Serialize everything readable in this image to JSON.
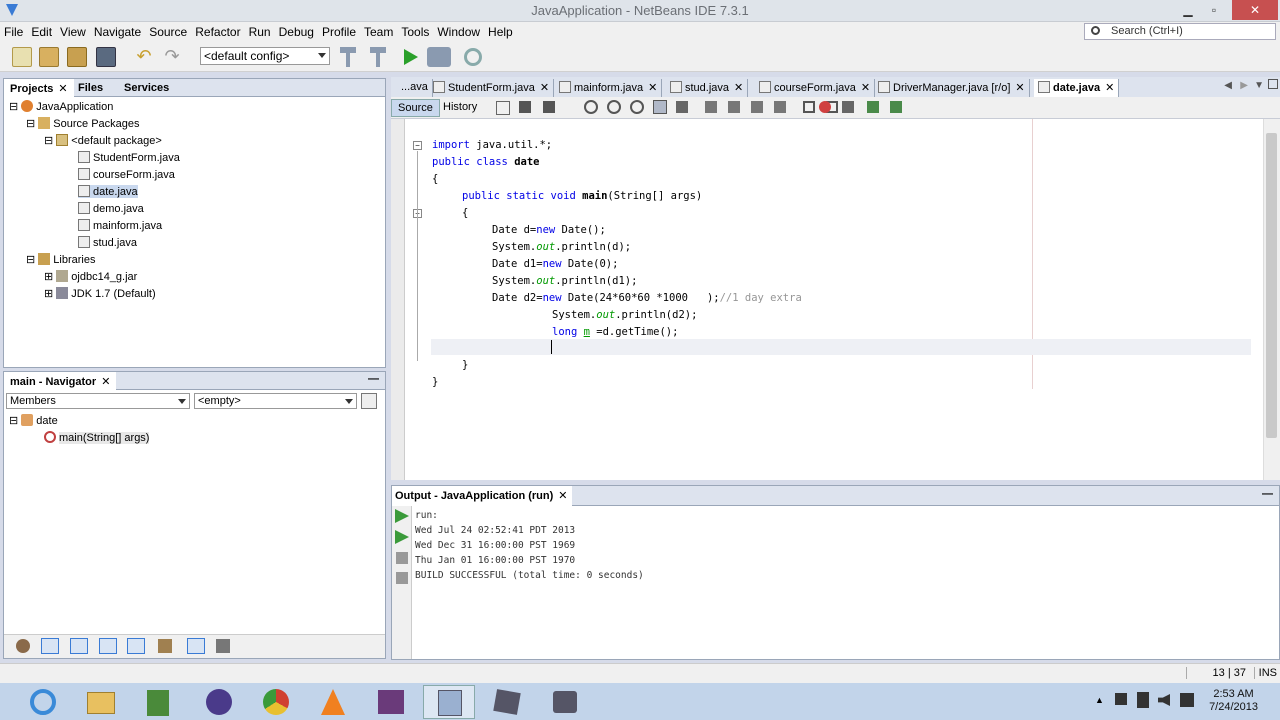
{
  "window": {
    "title": "JavaApplication - NetBeans IDE 7.3.1"
  },
  "menu": [
    "File",
    "Edit",
    "View",
    "Navigate",
    "Source",
    "Refactor",
    "Run",
    "Debug",
    "Profile",
    "Team",
    "Tools",
    "Window",
    "Help"
  ],
  "search": {
    "placeholder": "Search (Ctrl+I)"
  },
  "toolbar": {
    "config": "<default config>"
  },
  "projects": {
    "tabs": [
      "Projects",
      "Files",
      "Services"
    ],
    "tree": [
      "JavaApplication",
      "Source Packages",
      "<default package>",
      "StudentForm.java",
      "courseForm.java",
      "date.java",
      "demo.java",
      "mainform.java",
      "stud.java",
      "Libraries",
      "ojdbc14_g.jar",
      "JDK 1.7 (Default)"
    ]
  },
  "navigator": {
    "title": "main - Navigator",
    "members_label": "Members",
    "filter": "<empty>",
    "class_name": "date",
    "method": "main(String[] args)"
  },
  "editor": {
    "tabs": [
      "...ava",
      "StudentForm.java",
      "mainform.java",
      "stud.java",
      "courseForm.java",
      "DriverManager.java [r/o]",
      "date.java"
    ],
    "source_label": "Source",
    "history_label": "History"
  },
  "output": {
    "title": "Output - JavaApplication (run)",
    "lines": [
      "run:",
      "Wed Jul 24 02:52:41 PDT 2013",
      "Wed Dec 31 16:00:00 PST 1969",
      "Thu Jan 01 16:00:00 PST 1970",
      "BUILD SUCCESSFUL (total time: 0 seconds)"
    ]
  },
  "status": {
    "position": "13 | 37",
    "mode": "INS"
  },
  "clock": {
    "time": "2:53 AM",
    "date": "7/24/2013"
  }
}
